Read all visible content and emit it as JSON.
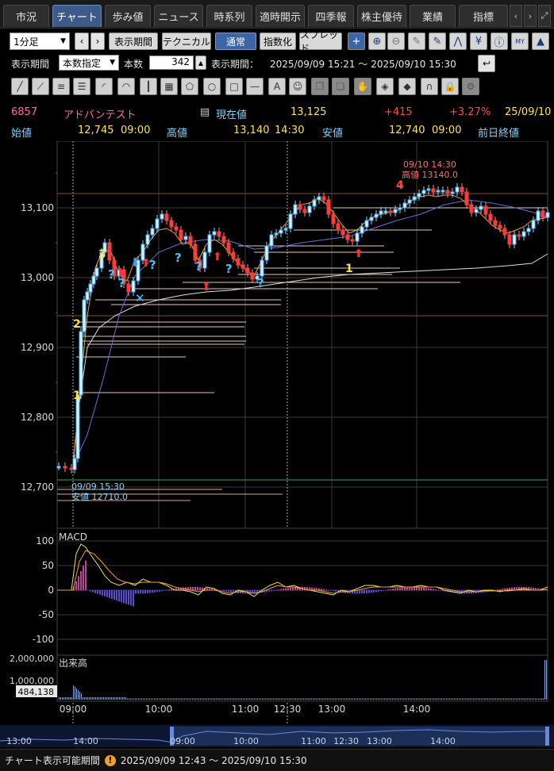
{
  "tabs": [
    "市況",
    "チャート",
    "歩み値",
    "ニュース",
    "時系列",
    "適時開示",
    "四季報",
    "株主優待",
    "業績",
    "指標"
  ],
  "active_tab": "チャート",
  "toolbar": {
    "interval": "1分足",
    "display_period_btn": "表示期間",
    "technical_btn": "テクニカル",
    "normal_btn": "通常",
    "index_btn": "指数化",
    "spread_btn": "スプレッド"
  },
  "period": {
    "label": "表示期間",
    "mode": "本数指定",
    "count_label": "本数",
    "count": "342",
    "range_label": "表示期間：",
    "range": "2025/09/09 15:21 ～ 2025/09/10 15:30"
  },
  "quote": {
    "code": "6857",
    "name": "アドバンテスト",
    "current_label": "現在値",
    "current": "13,125",
    "change": "+415",
    "change_pct": "+3.27%",
    "date": "25/09/10",
    "open_label": "始値",
    "open": "12,745",
    "open_time": "09:00",
    "high_label": "高値",
    "high": "13,140",
    "high_time": "14:30",
    "low_label": "安値",
    "low": "12,740",
    "low_time": "09:00",
    "prev_close_label": "前日終値"
  },
  "chart": {
    "price_ticks": [
      "13,100",
      "13,000",
      "12,900",
      "12,800",
      "12,700"
    ],
    "annotation_high_time": "09/10 14:30",
    "annotation_high": "高値 13140.0",
    "annotation_low_time": "09/09 15:30",
    "annotation_low": "安値 12710.0",
    "macd_label": "MACD",
    "macd_ticks": [
      "100",
      "50",
      "0",
      "-50",
      "-100"
    ],
    "volume_label": "出来高",
    "volume_ticks": [
      "2,000,000",
      "1,000,000"
    ],
    "volume_current": "484,138",
    "time_ticks": [
      "09:00",
      "10:00",
      "11:00",
      "12:30",
      "13:00",
      "14:00"
    ],
    "nav_ticks": [
      "13:00",
      "14:00",
      "09:00",
      "10:00",
      "11:00",
      "12:30",
      "13:00",
      "14:00"
    ],
    "wave_labels": [
      "1",
      "2",
      "3",
      "4",
      "1"
    ],
    "colors": {
      "up": "#3ab0ff",
      "down": "#ff3b3b",
      "ma_short": "#f0a020",
      "ma_mid": "#6a6ae0",
      "ma_long": "#dddddd",
      "grid": "#3a3a3a",
      "resistance": "#8a4a30"
    }
  },
  "status": {
    "label": "チャート表示可能期間",
    "range": "2025/09/09 12:43 ～ 2025/09/10 15:30"
  }
}
